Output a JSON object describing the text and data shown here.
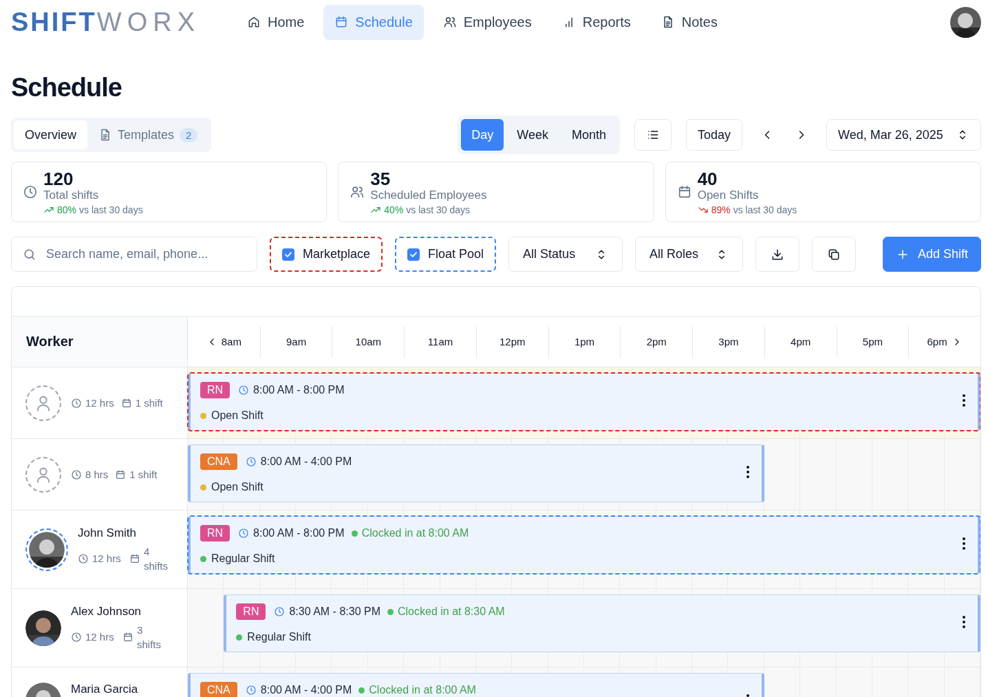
{
  "brand": {
    "part_1": "SHIFT",
    "part_2": "WORX"
  },
  "nav": [
    {
      "label": "Home",
      "selected": false
    },
    {
      "label": "Schedule",
      "selected": true
    },
    {
      "label": "Employees",
      "selected": false
    },
    {
      "label": "Reports",
      "selected": false
    },
    {
      "label": "Notes",
      "selected": false
    }
  ],
  "page_title": "Schedule",
  "view_tabs": [
    {
      "label": "Overview",
      "selected": true
    },
    {
      "label": "Templates",
      "badge": "2",
      "selected": false
    }
  ],
  "range_tabs": [
    {
      "label": "Day",
      "selected": true
    },
    {
      "label": "Week",
      "selected": false
    },
    {
      "label": "Month",
      "selected": false
    }
  ],
  "today_button": "Today",
  "date": "Wed, Mar 26, 2025",
  "stats": [
    {
      "value": "120",
      "label": "Total shifts",
      "change": "80%",
      "rising": true,
      "comparison": "vs last 30 days"
    },
    {
      "value": "35",
      "label": "Scheduled Employees",
      "change": "40%",
      "rising": true,
      "comparison": "vs last 30 days"
    },
    {
      "value": "40",
      "label": "Open Shifts",
      "change": "89%",
      "rising": false,
      "comparison": "vs last 30 days"
    }
  ],
  "search": {
    "placeholder": "Search name, email, phone..."
  },
  "filters": [
    {
      "label": "Marketplace",
      "checked": true,
      "color": "#dc2626"
    },
    {
      "label": "Float Pool",
      "checked": true,
      "color": "#3b82f6"
    }
  ],
  "selects": [
    "All Status",
    "All Roles"
  ],
  "add_button": "Add Shift",
  "schedule": {
    "worker_header": "Worker",
    "hours": [
      "8am",
      "9am",
      "10am",
      "11am",
      "12pm",
      "1pm",
      "2pm",
      "3pm",
      "4pm",
      "5pm",
      "6pm"
    ],
    "rows": [
      {
        "kind": "open",
        "marketplace": true,
        "float_pool": false,
        "hours": "12 hrs",
        "shifts": "1 shift",
        "shift": {
          "role": {
            "label": "RN",
            "color": "#db4f91"
          },
          "time": "8:00 AM - 8:00 PM",
          "status": {
            "label": "Open Shift",
            "color": "#e5b83b"
          }
        }
      },
      {
        "kind": "open",
        "marketplace": false,
        "float_pool": false,
        "hours": "8 hrs",
        "shifts": "1 shift",
        "shift": {
          "role": {
            "label": "CNA",
            "color": "#e8792f"
          },
          "time": "8:00 AM - 4:00 PM",
          "status": {
            "label": "Open Shift",
            "color": "#e5b83b"
          }
        }
      },
      {
        "kind": "worker",
        "name": "John Smith",
        "marketplace": false,
        "float_pool": true,
        "hours": "12 hrs",
        "shifts": "4 shifts",
        "shift": {
          "role": {
            "label": "RN",
            "color": "#db4f91"
          },
          "time": "8:00 AM - 8:00 PM",
          "clock_in": "Clocked in at 8:00 AM",
          "status": {
            "label": "Regular Shift",
            "color": "#4cc063"
          }
        }
      },
      {
        "kind": "worker",
        "name": "Alex Johnson",
        "marketplace": false,
        "float_pool": false,
        "hours": "12 hrs",
        "shifts": "3 shifts",
        "shift": {
          "role": {
            "label": "RN",
            "color": "#db4f91"
          },
          "time": "8:30 AM - 8:30 PM",
          "clock_in": "Clocked in at 8:30 AM",
          "status": {
            "label": "Regular Shift",
            "color": "#4cc063"
          }
        }
      },
      {
        "kind": "worker",
        "name": "Maria Garcia",
        "marketplace": false,
        "float_pool": false,
        "shift": {
          "role": {
            "label": "CNA",
            "color": "#e8792f"
          },
          "time": "8:00 AM - 4:00 PM",
          "clock_in": "Clocked in at 8:00 AM"
        }
      }
    ]
  }
}
